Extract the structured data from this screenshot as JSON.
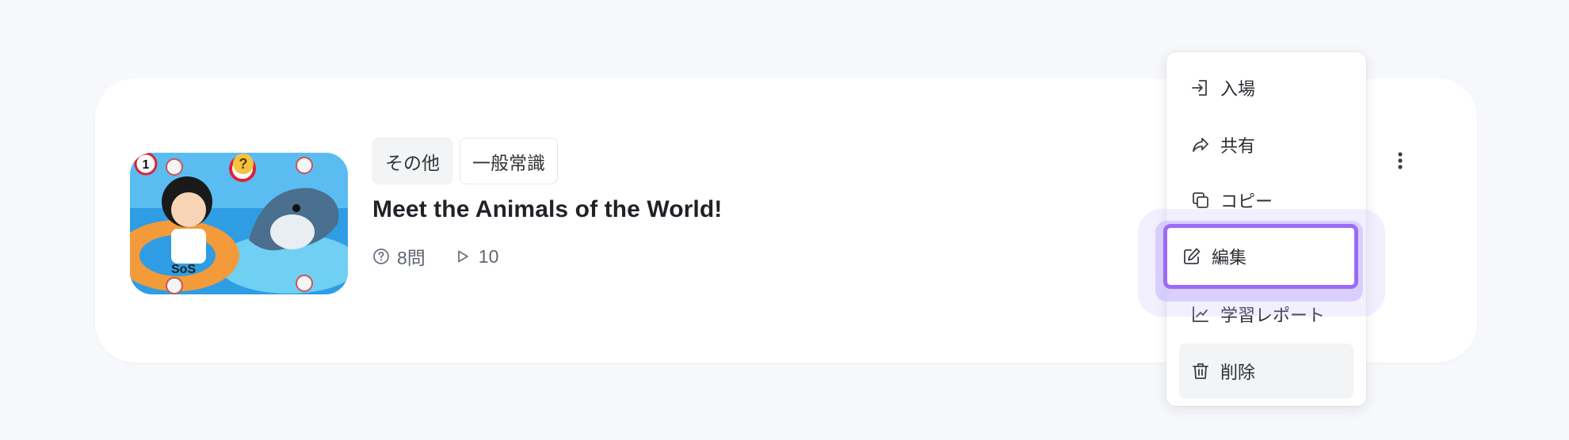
{
  "card": {
    "tags": [
      "その他",
      "一般常識"
    ],
    "title": "Meet the Animals of the World!",
    "question_count": "8問",
    "play_count": "10",
    "thumbnail_badge": "1",
    "thumbnail_text": "SoS"
  },
  "menu": {
    "items": [
      {
        "label": "入場",
        "icon": "enter-icon"
      },
      {
        "label": "共有",
        "icon": "share-icon"
      },
      {
        "label": "コピー",
        "icon": "copy-icon"
      },
      {
        "label": "編集",
        "icon": "edit-icon"
      },
      {
        "label": "学習レポート",
        "icon": "report-icon"
      },
      {
        "label": "削除",
        "icon": "trash-icon"
      }
    ],
    "focused_item": "編集",
    "hovered_item": "削除"
  },
  "colors": {
    "focus": "#9b6bf7",
    "card": "#ffffff",
    "background": "#f7f8fb"
  }
}
